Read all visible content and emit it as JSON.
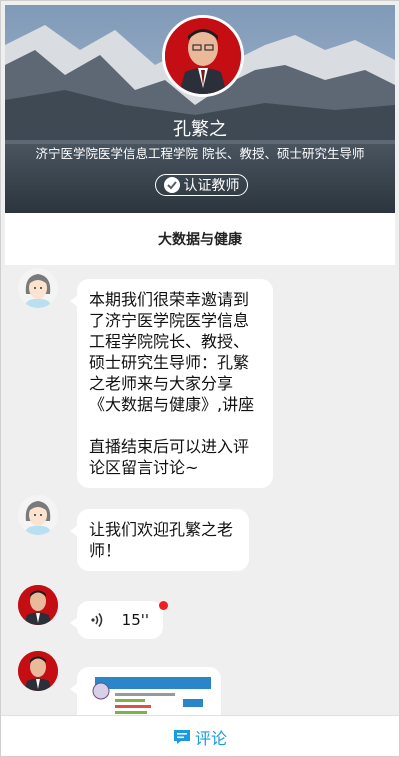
{
  "teacher": {
    "name": "孔繁之",
    "title": "济宁医学院医学信息工程学院 院长、教授、硕士研究生导师",
    "badge": "认证教师"
  },
  "topic": "大数据与健康",
  "messages": [
    {
      "type": "text",
      "sender": "host",
      "text": "本期我们很荣幸邀请到了济宁医学院医学信息工程学院院长、教授、硕士研究生导师：孔繁之老师来与大家分享《大数据与健康》,讲座\n\n直播结束后可以进入评论区留言讨论~"
    },
    {
      "type": "text",
      "sender": "host",
      "text": "让我们欢迎孔繁之老师！"
    },
    {
      "type": "voice",
      "sender": "teacher",
      "duration": "15''",
      "unread": true
    },
    {
      "type": "image",
      "sender": "teacher"
    }
  ],
  "footer": {
    "comment_label": "评论"
  },
  "colors": {
    "accent": "#1a9ae0",
    "unread_dot": "#f01e1e",
    "avatar_red": "#c40e14"
  }
}
